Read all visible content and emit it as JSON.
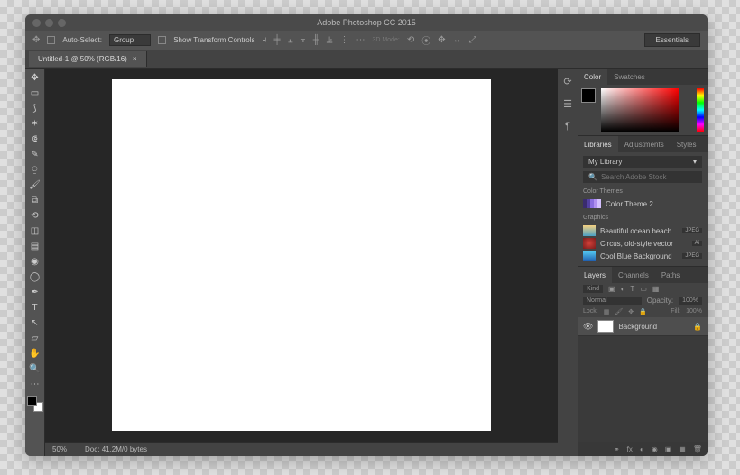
{
  "title": "Adobe Photoshop CC 2015",
  "optbar": {
    "auto_select": "Auto-Select:",
    "group": "Group",
    "show_transform": "Show Transform Controls",
    "workspace": "Essentials"
  },
  "tab": {
    "label": "Untitled-1 @ 50% (RGB/16)",
    "close": "×"
  },
  "status": {
    "zoom": "50%",
    "doc": "Doc: 41.2M/0 bytes"
  },
  "color_tabs": {
    "color": "Color",
    "swatches": "Swatches"
  },
  "lib_tabs": {
    "libraries": "Libraries",
    "adjustments": "Adjustments",
    "styles": "Styles"
  },
  "libraries": {
    "select": "My Library",
    "search": "Search Adobe Stock",
    "section1": "Color Themes",
    "theme_name": "Color Theme 2",
    "section2": "Graphics",
    "items": [
      {
        "name": "Beautiful ocean beach",
        "badge": "JPEG",
        "bg": "linear-gradient(#f5d080,#4aa0c5)"
      },
      {
        "name": "Circus, old-style vector",
        "badge": "Ai",
        "bg": "radial-gradient(#d04038,#7a1c1c)"
      },
      {
        "name": "Cool Blue Background",
        "badge": "JPEG",
        "bg": "linear-gradient(#58d0f5,#2060b0)"
      }
    ]
  },
  "layer_tabs": {
    "layers": "Layers",
    "channels": "Channels",
    "paths": "Paths"
  },
  "layers": {
    "kind": "Kind",
    "blend": "Normal",
    "opacity_label": "Opacity:",
    "opacity": "100%",
    "lock_label": "Lock:",
    "fill_label": "Fill:",
    "fill": "100%",
    "background": "Background"
  }
}
